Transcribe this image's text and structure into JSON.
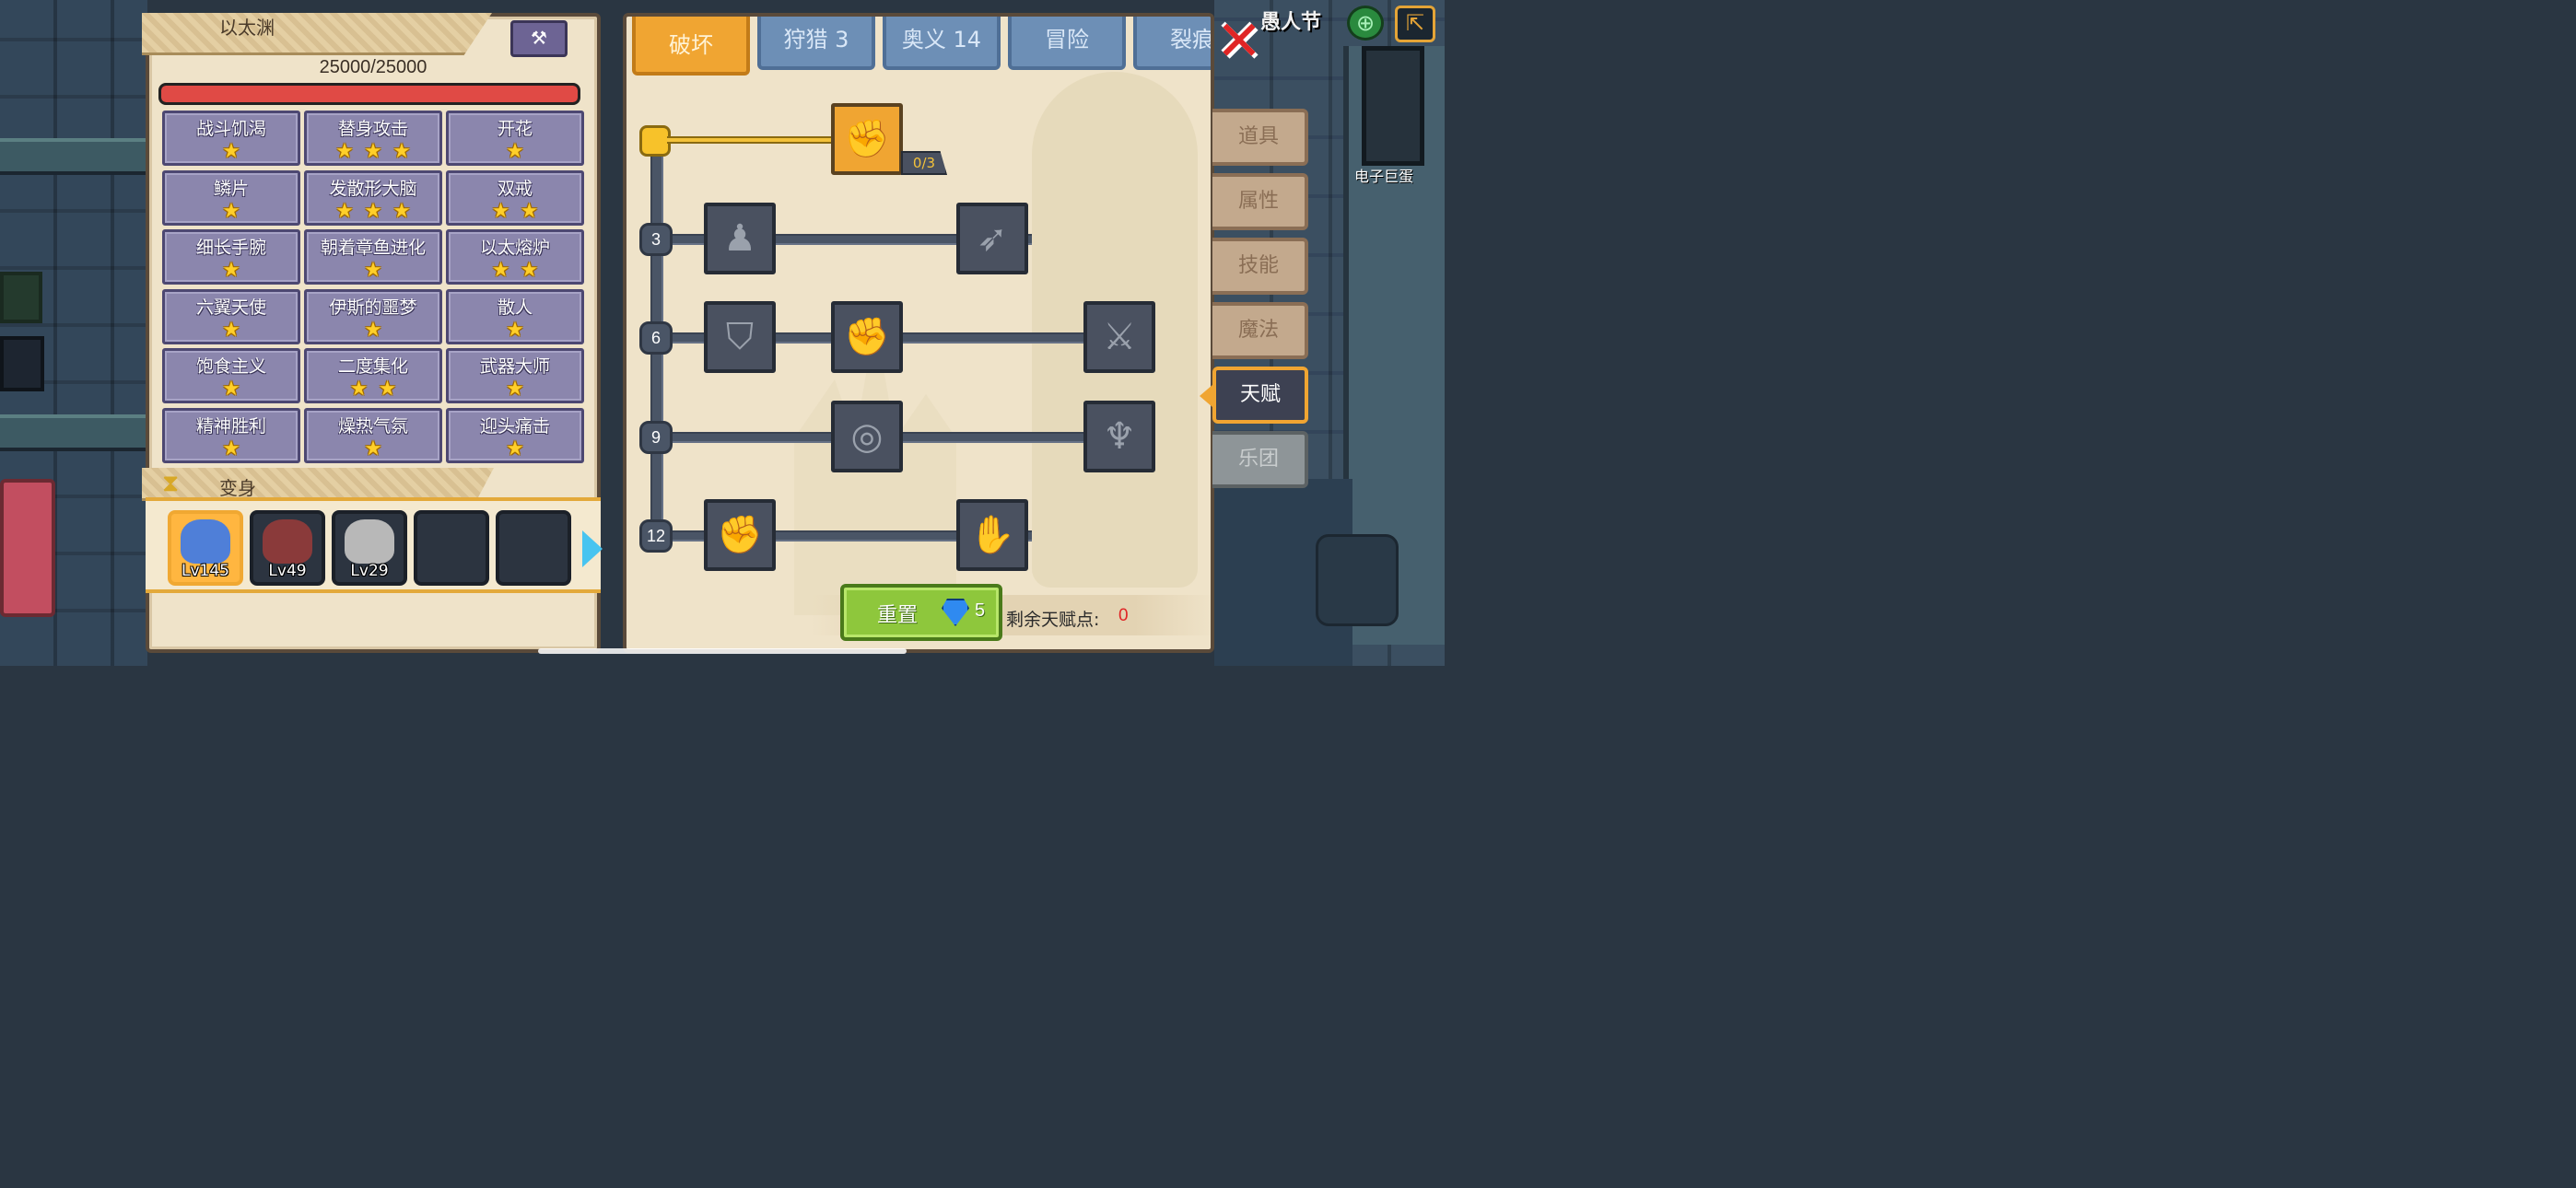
{
  "hud": {
    "event_label": "愚人节",
    "egg_label": "电子巨蛋",
    "globe_icon": "globe-icon",
    "exit_icon": "exit-icon"
  },
  "character": {
    "name_partial": "以太渊",
    "hp": "25000/25000",
    "hp_fraction": 1.0,
    "talents": [
      {
        "name": "战斗饥渴",
        "stars": 1
      },
      {
        "name": "替身攻击",
        "stars": 3
      },
      {
        "name": "开花",
        "stars": 1
      },
      {
        "name": "鳞片",
        "stars": 1
      },
      {
        "name": "发散形大脑",
        "stars": 3
      },
      {
        "name": "双戒",
        "stars": 2
      },
      {
        "name": "细长手腕",
        "stars": 1
      },
      {
        "name": "朝着章鱼进化",
        "stars": 1
      },
      {
        "name": "以太熔炉",
        "stars": 2
      },
      {
        "name": "六翼天使",
        "stars": 1
      },
      {
        "name": "伊斯的噩梦",
        "stars": 1
      },
      {
        "name": "散人",
        "stars": 1
      },
      {
        "name": "饱食主义",
        "stars": 1
      },
      {
        "name": "二度集化",
        "stars": 2
      },
      {
        "name": "武器大师",
        "stars": 1
      },
      {
        "name": "精神胜利",
        "stars": 1
      },
      {
        "name": "燥热气氛",
        "stars": 1
      },
      {
        "name": "迎头痛击",
        "stars": 1
      }
    ],
    "transform_label": "变身",
    "skins": [
      {
        "level": "Lv145",
        "selected": true,
        "color": "#4f7fd8"
      },
      {
        "level": "Lv49",
        "selected": false,
        "color": "#8a3a3a"
      },
      {
        "level": "Lv29",
        "selected": false,
        "color": "#b8b8b8"
      },
      {
        "level": "",
        "selected": false,
        "color": ""
      },
      {
        "level": "",
        "selected": false,
        "color": ""
      }
    ]
  },
  "talent_tree": {
    "tabs": [
      {
        "label": "破坏",
        "active": true
      },
      {
        "label": "狩猎 3",
        "active": false
      },
      {
        "label": "奥义 14",
        "active": false
      },
      {
        "label": "冒险",
        "active": false
      },
      {
        "label": "裂痕",
        "active": false
      }
    ],
    "tiers": [
      "3",
      "6",
      "9",
      "12"
    ],
    "top_node": {
      "icon": "arm-wrestle-icon",
      "count": "0/3"
    },
    "reset_label": "重置",
    "reset_cost": "5",
    "remaining_label": "剩余天赋点:",
    "remaining_value": "0"
  },
  "side_menu": [
    {
      "label": "道具",
      "state": "normal"
    },
    {
      "label": "属性",
      "state": "normal"
    },
    {
      "label": "技能",
      "state": "normal"
    },
    {
      "label": "魔法",
      "state": "normal"
    },
    {
      "label": "天赋",
      "state": "active"
    },
    {
      "label": "乐团",
      "state": "grey"
    }
  ],
  "colors": {
    "accent_orange": "#f0a532",
    "star_gold": "#ffcf29",
    "hp_red": "#e04a45",
    "reset_green": "#8ec73c",
    "remaining_red": "#e02525"
  }
}
